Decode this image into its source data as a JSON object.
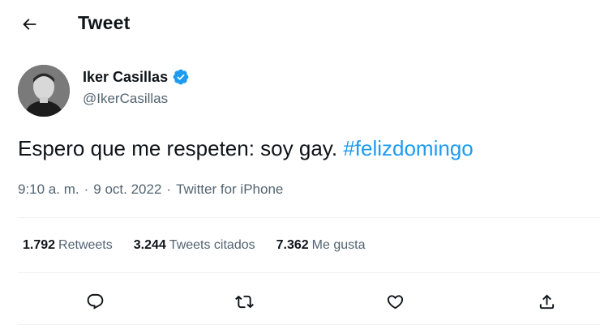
{
  "header": {
    "title": "Tweet",
    "back_icon": "arrow-left-icon"
  },
  "author": {
    "name": "Iker Casillas",
    "handle": "@IkerCasillas",
    "verified_icon": "verified-badge-icon",
    "verified_color": "#1d9bf0"
  },
  "tweet": {
    "text": "Espero que me respeten: soy gay.",
    "hashtag": "#felizdomingo",
    "time": "9:10 a. m.",
    "date": "9 oct. 2022",
    "source": "Twitter for iPhone",
    "separator": "·"
  },
  "stats": [
    {
      "count": "1.792",
      "label": "Retweets"
    },
    {
      "count": "3.244",
      "label": "Tweets citados"
    },
    {
      "count": "7.362",
      "label": "Me gusta"
    }
  ],
  "actions": [
    "reply-icon",
    "retweet-icon",
    "like-icon",
    "share-icon"
  ],
  "colors": {
    "accent": "#1d9bf0",
    "text": "#0f1419",
    "secondary": "#536471",
    "border": "#eff3f4"
  }
}
